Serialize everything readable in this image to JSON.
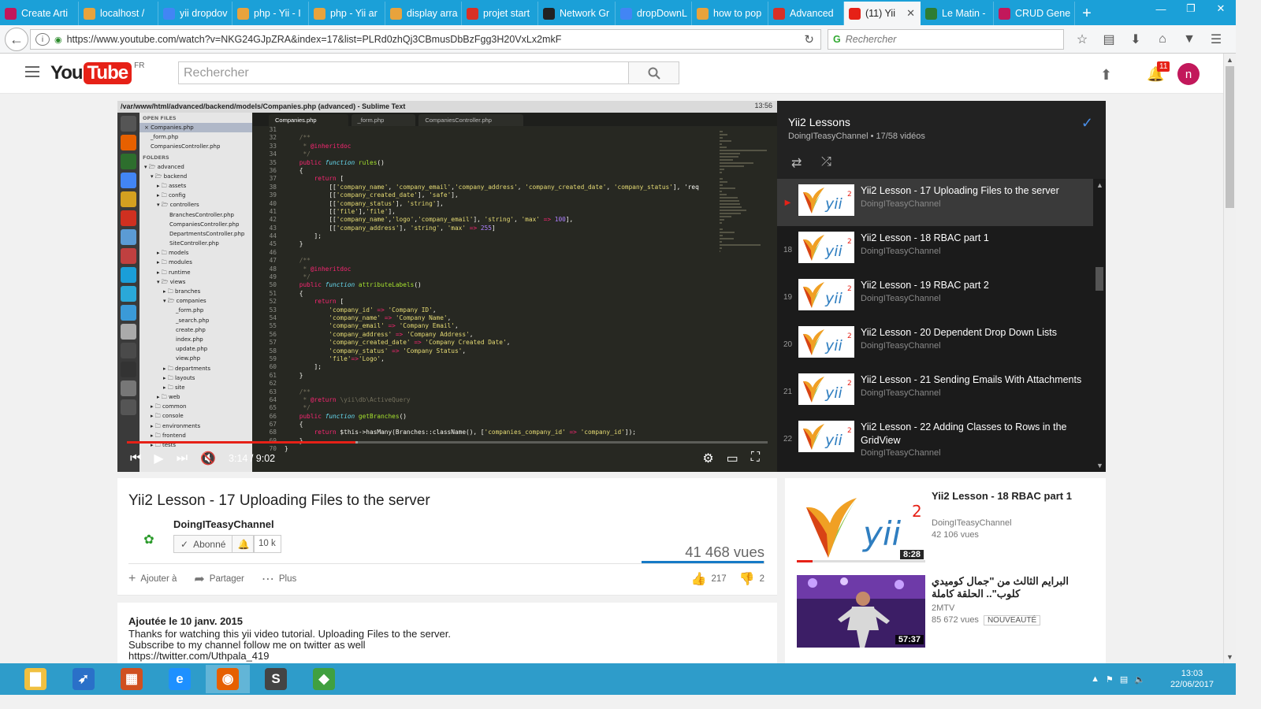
{
  "browser": {
    "tabs": [
      {
        "label": "Create Arti",
        "fav": "#c2185b",
        "icon": "circle-w"
      },
      {
        "label": "localhost /",
        "fav": "#e8a33c",
        "icon": "phpmyadmin"
      },
      {
        "label": "yii dropdov",
        "fav": "#4285f4",
        "icon": "google"
      },
      {
        "label": "php - Yii - I",
        "fav": "#e8a33c",
        "icon": "yii"
      },
      {
        "label": "php - Yii ar",
        "fav": "#e8a33c",
        "icon": "yii"
      },
      {
        "label": "display arra",
        "fav": "#e8a33c",
        "icon": "yii"
      },
      {
        "label": "projet start",
        "fav": "#d93025",
        "icon": "gmail"
      },
      {
        "label": "Network Gr",
        "fav": "#222222",
        "icon": "github"
      },
      {
        "label": "dropDownL",
        "fav": "#4285f4",
        "icon": "google"
      },
      {
        "label": "how to pop",
        "fav": "#e8a33c",
        "icon": "yii"
      },
      {
        "label": "Advanced",
        "fav": "#d93025",
        "icon": "gmail"
      },
      {
        "label": "(11) Yii",
        "fav": "#e62117",
        "icon": "youtube",
        "active": true
      },
      {
        "label": "Le Matin -",
        "fav": "#2e7d32",
        "icon": "m"
      },
      {
        "label": "CRUD Gene",
        "fav": "#c2185b",
        "icon": "circle-w"
      }
    ],
    "url": "https://www.youtube.com/watch?v=NKG24GJpZRA&index=17&list=PLRd0zhQj3CBmusDbBzFgg3H20VxLx2mkF",
    "search_placeholder": "Rechercher"
  },
  "youtube": {
    "logo_you": "You",
    "logo_tube": "Tube",
    "logo_region": "FR",
    "search_placeholder": "Rechercher",
    "notifications": "11",
    "avatar_letter": "n"
  },
  "player": {
    "window_title": "/var/www/html/advanced/backend/models/Companies.php (advanced) - Sublime Text",
    "clock": "13:56",
    "tabs": [
      "Companies.php",
      "_form.php",
      "CompaniesController.php"
    ],
    "sidebar": [
      {
        "t": "OPEN FILES",
        "h": true
      },
      {
        "t": "× Companies.php",
        "i": 0,
        "sel": true
      },
      {
        "t": "_form.php",
        "i": 1
      },
      {
        "t": "CompaniesController.php",
        "i": 1
      },
      {
        "t": "FOLDERS",
        "h": true
      },
      {
        "t": "▾ 🗁 advanced",
        "i": 0
      },
      {
        "t": "▾ 🗁 backend",
        "i": 1
      },
      {
        "t": "▸ 🗀 assets",
        "i": 2
      },
      {
        "t": "▸ 🗀 config",
        "i": 2
      },
      {
        "t": "▾ 🗁 controllers",
        "i": 2
      },
      {
        "t": "BranchesController.php",
        "i": 4
      },
      {
        "t": "CompaniesController.php",
        "i": 4
      },
      {
        "t": "DepartmentsController.php",
        "i": 4
      },
      {
        "t": "SiteController.php",
        "i": 4
      },
      {
        "t": "▸ 🗀 models",
        "i": 2
      },
      {
        "t": "▸ 🗀 modules",
        "i": 2
      },
      {
        "t": "▸ 🗀 runtime",
        "i": 2
      },
      {
        "t": "▾ 🗁 views",
        "i": 2
      },
      {
        "t": "▸ 🗀 branches",
        "i": 3
      },
      {
        "t": "▾ 🗁 companies",
        "i": 3
      },
      {
        "t": "_form.php",
        "i": 5
      },
      {
        "t": "_search.php",
        "i": 5
      },
      {
        "t": "create.php",
        "i": 5
      },
      {
        "t": "index.php",
        "i": 5
      },
      {
        "t": "update.php",
        "i": 5
      },
      {
        "t": "view.php",
        "i": 5
      },
      {
        "t": "▸ 🗀 departments",
        "i": 3
      },
      {
        "t": "▸ 🗀 layouts",
        "i": 3
      },
      {
        "t": "▸ 🗀 site",
        "i": 3
      },
      {
        "t": "▸ 🗀 web",
        "i": 2
      },
      {
        "t": "▸ 🗀 common",
        "i": 1
      },
      {
        "t": "▸ 🗀 console",
        "i": 1
      },
      {
        "t": "▸ 🗀 environments",
        "i": 1
      },
      {
        "t": "▸ 🗀 frontend",
        "i": 1
      },
      {
        "t": "▸ 🗀 tests",
        "i": 1
      }
    ],
    "line_start": 31,
    "code": [
      "",
      "    /**",
      "     * @inheritdoc",
      "     */",
      "    public function rules()",
      "    {",
      "        return [",
      "            [['company_name', 'company_email','company_address', 'company_created_date', 'company_status'], 'req",
      "            [['company_created_date'], 'safe'],",
      "            [['company_status'], 'string'],",
      "            [['file'],'file'],",
      "            [['company_name','logo','company_email'], 'string', 'max' => 100],",
      "            [['company_address'], 'string', 'max' => 255]",
      "        ];",
      "    }",
      "",
      "    /**",
      "     * @inheritdoc",
      "     */",
      "    public function attributeLabels()",
      "    {",
      "        return [",
      "            'company_id' => 'Company ID',",
      "            'company_name' => 'Company Name',",
      "            'company_email' => 'Company Email',",
      "            'company_address' => 'Company Address',",
      "            'company_created_date' => 'Company Created Date',",
      "            'company_status' => 'Company Status',",
      "            'file'=>'Logo',",
      "        ];",
      "    }",
      "",
      "    /**",
      "     * @return \\yii\\db\\ActiveQuery",
      "     */",
      "    public function getBranches()",
      "    {",
      "        return $this->hasMany(Branches::className(), ['companies_company_id' => 'company_id']);",
      "    }",
      "}"
    ],
    "time": "3:14 / 9:02",
    "progress": 0.3573,
    "buffered": 0.36
  },
  "playlist": {
    "title": "Yii2 Lessons",
    "subtitle": "DoingITeasyChannel • 17/58 vidéos",
    "items": [
      {
        "num": "▶",
        "title": "Yii2 Lesson - 17 Uploading Files to the server",
        "channel": "DoingITeasyChannel",
        "current": true
      },
      {
        "num": "18",
        "title": "Yii2 Lesson - 18 RBAC part 1",
        "channel": "DoingITeasyChannel"
      },
      {
        "num": "19",
        "title": "Yii2 Lesson - 19 RBAC part 2",
        "channel": "DoingITeasyChannel"
      },
      {
        "num": "20",
        "title": "Yii2 Lesson - 20 Dependent Drop Down Lists",
        "channel": "DoingITeasyChannel"
      },
      {
        "num": "21",
        "title": "Yii2 Lesson - 21 Sending Emails With Attachments",
        "channel": "DoingITeasyChannel"
      },
      {
        "num": "22",
        "title": "Yii2 Lesson - 22 Adding Classes to Rows in the GridView",
        "channel": "DoingITeasyChannel"
      }
    ]
  },
  "video": {
    "title": "Yii2 Lesson - 17 Uploading Files to the server",
    "channel": "DoingITeasyChannel",
    "subscribe_label": "Abonné",
    "subscriber_count": "10 k",
    "views": "41 468 vues",
    "like_ratio": 0.9909,
    "add_to": "Ajouter à",
    "share": "Partager",
    "more": "Plus",
    "likes": "217",
    "dislikes": "2"
  },
  "description": {
    "published": "Ajoutée le 10 janv. 2015",
    "lines": [
      "Thanks for watching this yii video tutorial. Uploading Files to the server.",
      "Subscribe to my channel follow me on twitter as well",
      "https://twitter.com/Uthpala_419"
    ]
  },
  "related": [
    {
      "title": "Yii2 Lesson - 18 RBAC part 1",
      "channel": "DoingITeasyChannel",
      "views": "42 106 vues",
      "duration": "8:28",
      "watched": 0.12
    },
    {
      "title": "البرايم الثالث من \"جمال كوميدي كلوب\".. الحلقة كاملة",
      "channel": "2MTV",
      "views": "85 672 vues",
      "duration": "57:37",
      "badge": "NOUVEAUTÉ"
    }
  ],
  "taskbar": {
    "apps": [
      "file-manager-icon",
      "rocket-icon",
      "paint-icon",
      "ie-icon",
      "firefox-icon",
      "sublime-icon",
      "gem-icon"
    ],
    "active_index": 4,
    "time": "13:03",
    "date": "22/06/2017"
  }
}
